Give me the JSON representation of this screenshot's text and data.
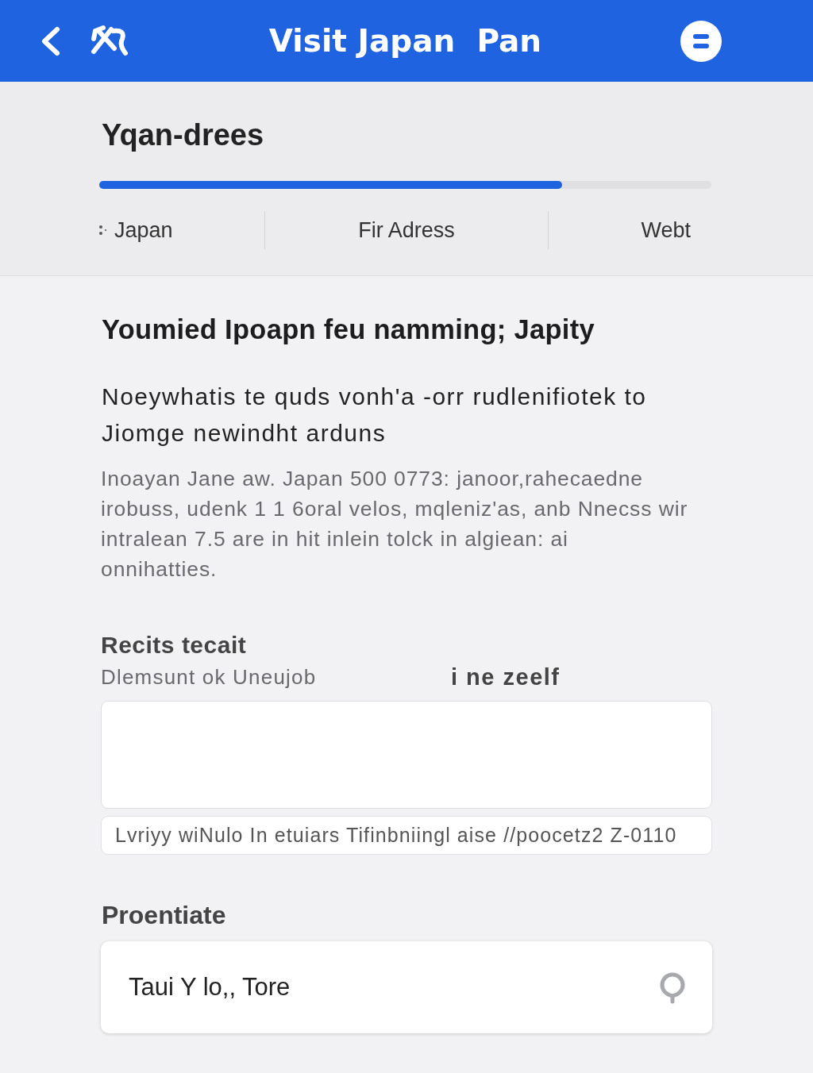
{
  "header": {
    "title": "Visit Japan  Pan"
  },
  "progress": {
    "title": "Yqan-drees",
    "level": 0.756,
    "steps": [
      {
        "label": "Japan",
        "kind": "handle"
      },
      {
        "label": "Fir Adress",
        "kind": "text"
      },
      {
        "label": "Webt",
        "kind": "text"
      }
    ]
  },
  "intro": {
    "heading": "Youmied Ipoapn feu namming; Japity",
    "lead_lines": [
      "Noeywhatis te quds vonh'a -orr rudlenifiotek to",
      "Jiomge newindht arduns"
    ],
    "detail_lines": [
      "Inoayan Jane aw. Japan 500 0773: janoor,rahecaedne",
      "irobuss, udenk 1 1 6oral velos, mqleniz'as, anb Nnecss wir",
      "intralean 7.5 are in hit inlein tolck in algiean: ai",
      "onnihatties."
    ]
  },
  "form": {
    "label": "Recits tecait",
    "sub_label": "Dlemsunt ok Uneujob",
    "side_label": "i ne zeelf",
    "note": "Lvriyy wiNulo In etuiars Tifinbniingl aise //poocetz2 Z-0110"
  },
  "location": {
    "label": "Proentiate",
    "value": "Taui Y lo,, Tore"
  }
}
